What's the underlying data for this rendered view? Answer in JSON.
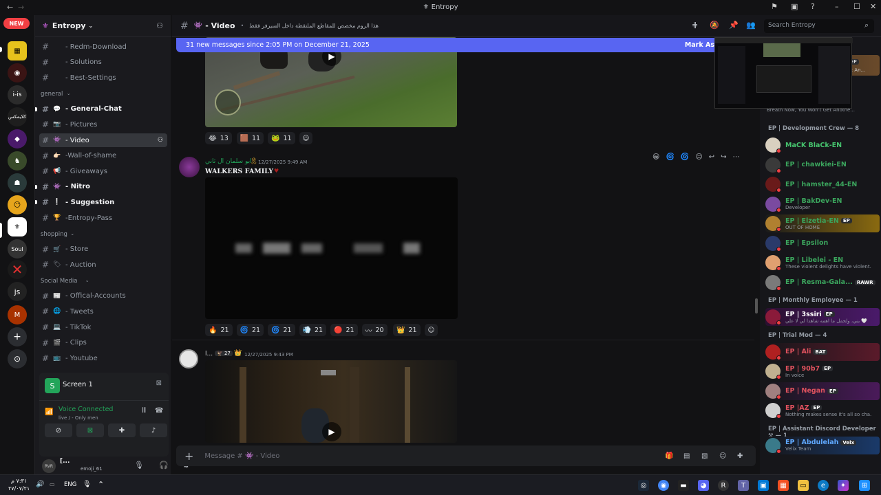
{
  "window": {
    "title": "Entropy"
  },
  "rail": {
    "new_badge": "NEW",
    "server_labels": [
      "i-is",
      "js",
      "Soul"
    ]
  },
  "guild": {
    "name": "Entropy"
  },
  "channels": [
    {
      "name": "- Redm-Download",
      "emoji": "",
      "style": "normal"
    },
    {
      "name": "- Solutions",
      "emoji": "",
      "style": "normal"
    },
    {
      "name": "- Best-Settings",
      "emoji": "",
      "style": "normal"
    },
    {
      "category": "general"
    },
    {
      "name": "- General-Chat",
      "emoji": "💬",
      "style": "unread"
    },
    {
      "name": "- Pictures",
      "emoji": "📷",
      "style": "normal"
    },
    {
      "name": "- Video",
      "emoji": "👾",
      "style": "selected"
    },
    {
      "name": "-Wall-of-shame",
      "emoji": "👉🏻",
      "style": "normal"
    },
    {
      "name": "- Giveaways",
      "emoji": "📢",
      "style": "normal"
    },
    {
      "name": "- Nitro",
      "emoji": "👾",
      "style": "unread"
    },
    {
      "name": "- Suggestion",
      "emoji": "❕",
      "style": "unread"
    },
    {
      "name": "-Entropy-Pass",
      "emoji": "🏆",
      "style": "normal"
    },
    {
      "category": "shopping"
    },
    {
      "name": "- Store",
      "emoji": "🛒",
      "style": "normal"
    },
    {
      "name": "- Auction",
      "emoji": "🏷",
      "style": "normal"
    },
    {
      "category": "Social Media"
    },
    {
      "name": "- Offical-Accounts",
      "emoji": "📰",
      "style": "normal"
    },
    {
      "name": "- Tweets",
      "emoji": "🌐",
      "style": "normal"
    },
    {
      "name": "- TikTok",
      "emoji": "💻",
      "style": "normal"
    },
    {
      "name": "- Clips",
      "emoji": "🎬",
      "style": "normal"
    },
    {
      "name": "- Youtube",
      "emoji": "📺",
      "style": "normal"
    }
  ],
  "stream": {
    "title": "Screen 1"
  },
  "voice": {
    "status": "Voice Connected",
    "location": "live / - Only men"
  },
  "user": {
    "name": "[...",
    "status": "emoji_61"
  },
  "header": {
    "channel": "- Video",
    "topic": "هذا الروم مخصص للمقاطع الملتقطة داخل السيرفر فقط",
    "search_placeholder": "Search Entropy"
  },
  "banner": {
    "text": "31 new messages since 2:05 PM on December 21, 2025",
    "action": "Mark As"
  },
  "messages": [
    {
      "reactions": [
        {
          "emoji": "😂",
          "count": "13"
        },
        {
          "emoji": "🟫",
          "count": "11"
        },
        {
          "emoji": "🐸",
          "count": "11"
        }
      ]
    },
    {
      "author": "ابو سلمان ال ثاني",
      "time": "12/27/2025 9:49 AM",
      "text": "WALKERS FAMILY",
      "reactions": [
        {
          "emoji": "🔥",
          "count": "21"
        },
        {
          "emoji": "🌀",
          "count": "21"
        },
        {
          "emoji": "🌀",
          "count": "21"
        },
        {
          "emoji": "💨",
          "count": "21"
        },
        {
          "emoji": "🔴",
          "count": "21"
        },
        {
          "emoji": "〰",
          "count": "20"
        },
        {
          "emoji": "👑",
          "count": "21"
        }
      ]
    },
    {
      "author": "l...",
      "badge": "27",
      "time": "12/27/2025 9:43 PM"
    }
  ],
  "composer": {
    "placeholder": "Message # 👾 - Video"
  },
  "members": {
    "groups": [
      {
        "header": "EP | Development Crew — 8",
        "items": [
          {
            "name": "MaCK BlaCk-EN",
            "color": "#46c46e",
            "sub": ""
          },
          {
            "name": "EP | chawkiei-EN",
            "color": "#3ba55d",
            "sub": ""
          },
          {
            "name": "EP | hamster_44-EN",
            "color": "#3ba55d",
            "sub": ""
          },
          {
            "name": "EP | BakDev-EN",
            "color": "#3ba55d",
            "sub": "Developer"
          },
          {
            "name": "EP | Elzetia-EN",
            "color": "#3ba55d",
            "sub": "OUT OF HOME",
            "tag": "EP"
          },
          {
            "name": "EP | Epsilon",
            "color": "#3ba55d",
            "sub": ""
          },
          {
            "name": "EP | Libelei - EN",
            "color": "#3ba55d",
            "sub": "These violent delights have violent..."
          },
          {
            "name": "EP | Resma-Gala...",
            "color": "#3ba55d",
            "sub": "",
            "tag": "RAWR"
          }
        ]
      },
      {
        "header": "EP | Monthly Employee — 1",
        "items": [
          {
            "name": "EP | 3ssiri",
            "color": "#ffffff",
            "sub": "بني، ولحمل ما اهمه شاهدا لي لا علي 🤍",
            "tag": "EP"
          }
        ]
      },
      {
        "header": "EP | Trial Mod — 4",
        "items": [
          {
            "name": "EP | Ali",
            "color": "#e0525e",
            "sub": "",
            "tag": "BAT"
          },
          {
            "name": "EP | 90b7",
            "color": "#e0525e",
            "sub": "In voice",
            "tag": "EP"
          },
          {
            "name": "EP | Negan",
            "color": "#e0525e",
            "sub": "",
            "tag": "EP"
          },
          {
            "name": "EP |AZ",
            "color": "#e0525e",
            "sub": "Nothing makes sense it's all so cha...",
            "tag": "EP"
          }
        ]
      },
      {
        "header": "EP | Assistant Discord Developer ⚒ — 1",
        "items": [
          {
            "name": "EP | Abdulelah",
            "color": "#5fa8ff",
            "sub": "Velix Team",
            "tag": "Velx"
          }
        ]
      }
    ],
    "peek": {
      "text": "Breath Now, You Won't Get Anothe...",
      "tag": "EP",
      "sub2": "et An..."
    }
  },
  "taskbar": {
    "time": "٧:٣١ م",
    "date": "٢٧/٠٧/٢١",
    "lang": "ENG"
  }
}
